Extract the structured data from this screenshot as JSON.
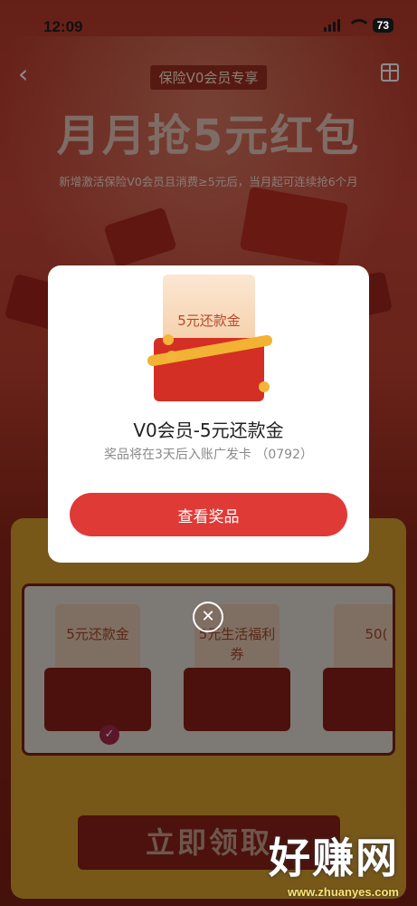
{
  "status_bar": {
    "time": "12:09",
    "battery": "73"
  },
  "background": {
    "tag": "保险V0会员专享",
    "hero_title": "月月抢5元红包",
    "subtitle": "新增激活保险V0会员且消费≥5元后，当月起可连续抢6个月",
    "prizes": [
      {
        "label": "5元还款金"
      },
      {
        "label": "5元生活福利券"
      },
      {
        "label": "50("
      }
    ],
    "claim_button": "立即领取"
  },
  "modal": {
    "illustration_label": "5元还款金",
    "title": "V0会员-5元还款金",
    "description": "奖品将在3天后入账广发卡 （0792）",
    "view_button": "查看奖品"
  },
  "watermark": {
    "text": "好赚网",
    "url": "www.zhuanyes.com"
  }
}
